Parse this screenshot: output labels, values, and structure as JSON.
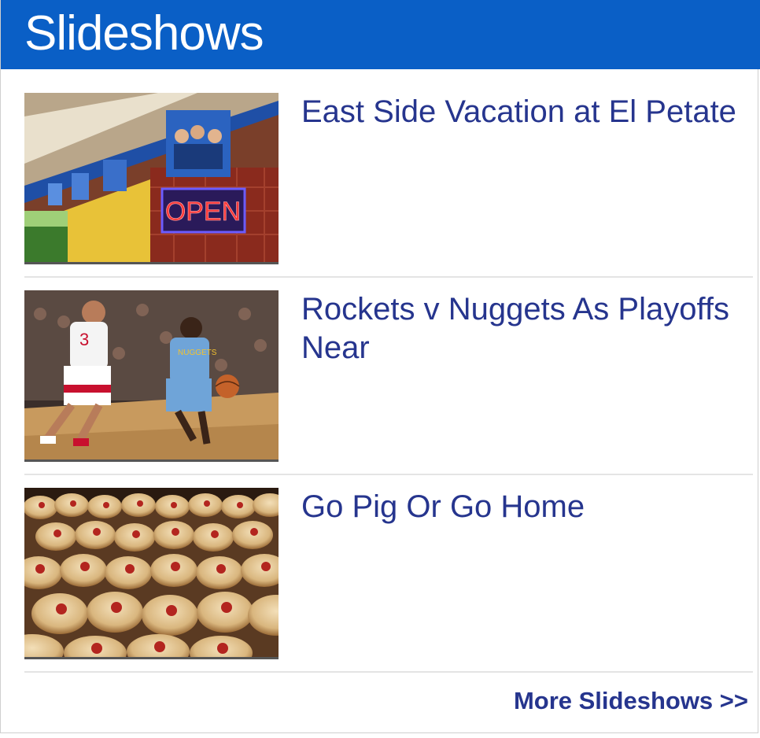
{
  "widget": {
    "title": "Slideshows",
    "header_color": "#0a5fc6",
    "link_color": "#26358e"
  },
  "items": [
    {
      "title": "East Side Vacation at El Petate",
      "thumbnail_sign_text": "OPEN"
    },
    {
      "title": "Rockets v Nuggets As Playoffs Near",
      "thumbnail_jersey_text": "3"
    },
    {
      "title": "Go Pig Or Go Home"
    }
  ],
  "footer": {
    "more_label": "More Slideshows >>"
  }
}
